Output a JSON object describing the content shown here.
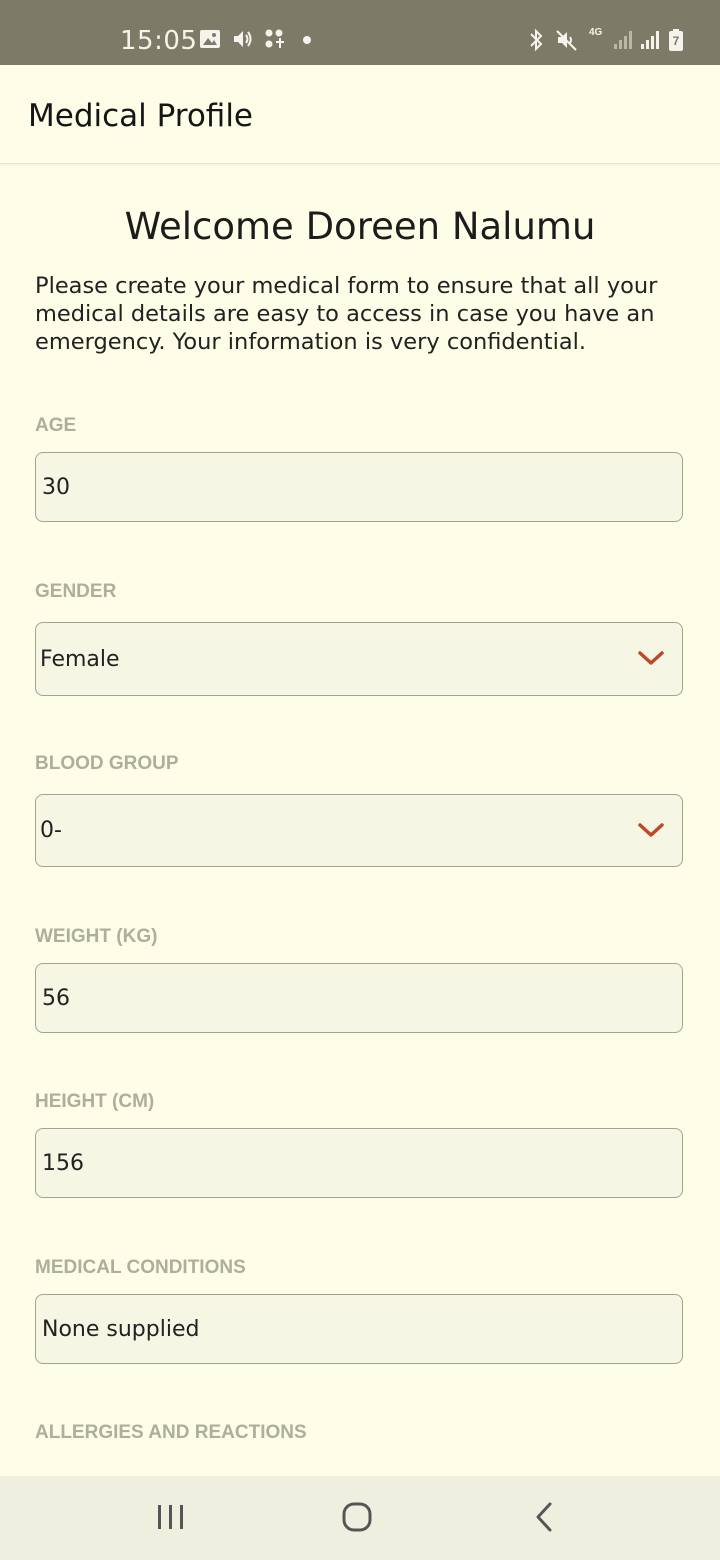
{
  "status_bar": {
    "time": "15:05",
    "left_icons": [
      "image-icon",
      "volume-icon",
      "notification-dots-icon",
      "dot-icon"
    ],
    "right_icons": [
      "bluetooth-icon",
      "mute-icon",
      "4g-icon",
      "signal-icon",
      "signal-icon",
      "battery-icon"
    ],
    "network_label": "4G",
    "battery_label": "7"
  },
  "app_bar": {
    "title": "Medical Profile"
  },
  "main": {
    "welcome": "Welcome Doreen Nalumu",
    "intro": "Please create your medical form to ensure that all your medical details are easy to access in case you have an emergency. Your information is very confidential."
  },
  "form": {
    "age": {
      "label": "AGE",
      "value": "30"
    },
    "gender": {
      "label": "GENDER",
      "value": "Female"
    },
    "blood_group": {
      "label": "BLOOD GROUP",
      "value": "0-"
    },
    "weight": {
      "label": "WEIGHT (KG)",
      "value": "56"
    },
    "height": {
      "label": "HEIGHT (CM)",
      "value": "156"
    },
    "medical_conditions": {
      "label": "MEDICAL CONDITIONS",
      "value": "None supplied"
    },
    "allergies": {
      "label": "ALLERGIES AND REACTIONS"
    }
  },
  "nav": {
    "icons": [
      "recent-apps-icon",
      "home-icon",
      "back-icon"
    ]
  },
  "colors": {
    "background": "#fdfde8",
    "status_bar": "#7d7b68",
    "label": "#aeae9c",
    "chevron_accent": "#c0482a"
  }
}
